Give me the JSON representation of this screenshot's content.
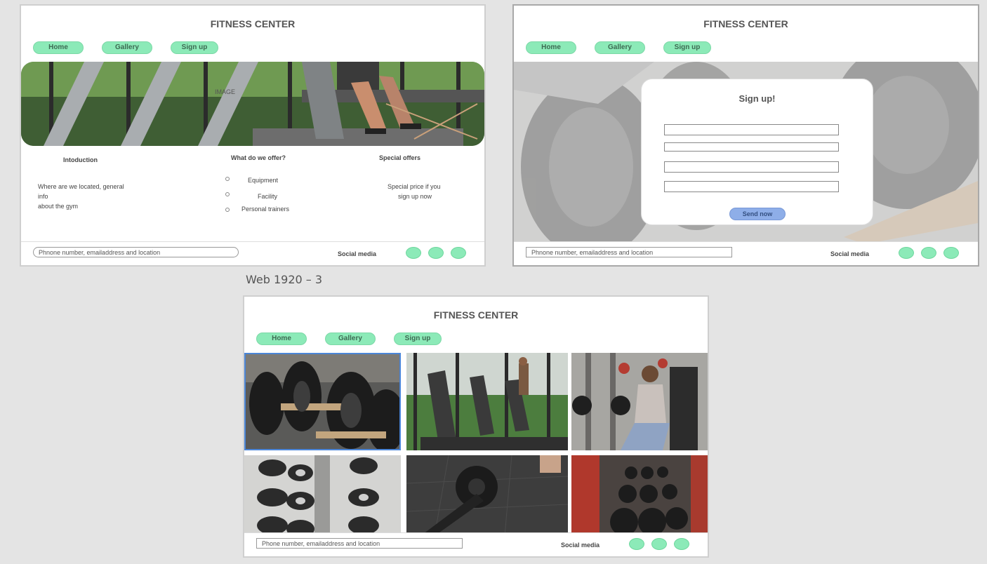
{
  "home": {
    "title": "FITNESS CENTER",
    "nav": [
      "Home",
      "Gallery",
      "Sign up"
    ],
    "hero_label": "IMAGE",
    "intro_heading": "Intoduction",
    "intro_text": [
      "Where are we located, general",
      "info",
      "about the gym"
    ],
    "offer_heading": "What do we offer?",
    "offer_items": [
      "Equipment",
      "Facility",
      "Personal trainers"
    ],
    "special_heading": "Special offers",
    "special_text": [
      "Special price if you",
      "sign up now"
    ],
    "footer": {
      "contact": "Phnone number, emailaddress and location",
      "social": "Social media"
    }
  },
  "signup": {
    "title": "FITNESS CENTER",
    "nav": [
      "Home",
      "Gallery",
      "Sign up"
    ],
    "modal_title": "Sign up!",
    "send": "Send now",
    "footer": {
      "contact": "Phnone number, emailaddress and location",
      "social": "Social media"
    }
  },
  "gallery": {
    "frame_label": "Web 1920 – 3",
    "title": "FITNESS CENTER",
    "nav": [
      "Home",
      "Gallery",
      "Sign up"
    ],
    "footer": {
      "contact": "Phone number, emailaddress and location",
      "social": "Social media"
    }
  },
  "colors": {
    "nav_green": "#8ceab8",
    "send_blue": "#8eaee8",
    "background": "#e4e4e4"
  }
}
